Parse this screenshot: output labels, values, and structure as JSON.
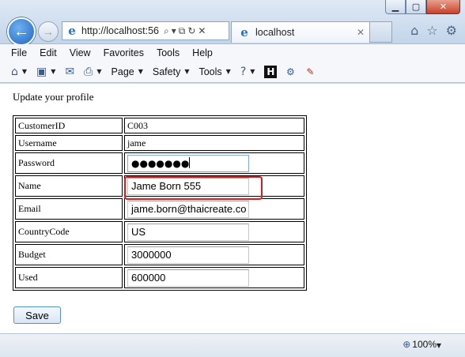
{
  "browser": {
    "address": "http://localhost:56",
    "tab_title": "localhost",
    "zoom": "100%"
  },
  "menu": [
    "File",
    "Edit",
    "View",
    "Favorites",
    "Tools",
    "Help"
  ],
  "commandbar": {
    "page": "Page",
    "safety": "Safety",
    "tools": "Tools"
  },
  "page": {
    "heading": "Update your profile",
    "rows": [
      {
        "label": "CustomerID",
        "value": "C003"
      },
      {
        "label": "Username",
        "value": "jame"
      },
      {
        "label": "Password",
        "value": "●●●●●●●"
      },
      {
        "label": "Name",
        "value": "Jame Born 555"
      },
      {
        "label": "Email",
        "value": "jame.born@thaicreate.co"
      },
      {
        "label": "CountryCode",
        "value": "US"
      },
      {
        "label": "Budget",
        "value": "3000000"
      },
      {
        "label": "Used",
        "value": "600000"
      }
    ],
    "save_label": "Save"
  }
}
